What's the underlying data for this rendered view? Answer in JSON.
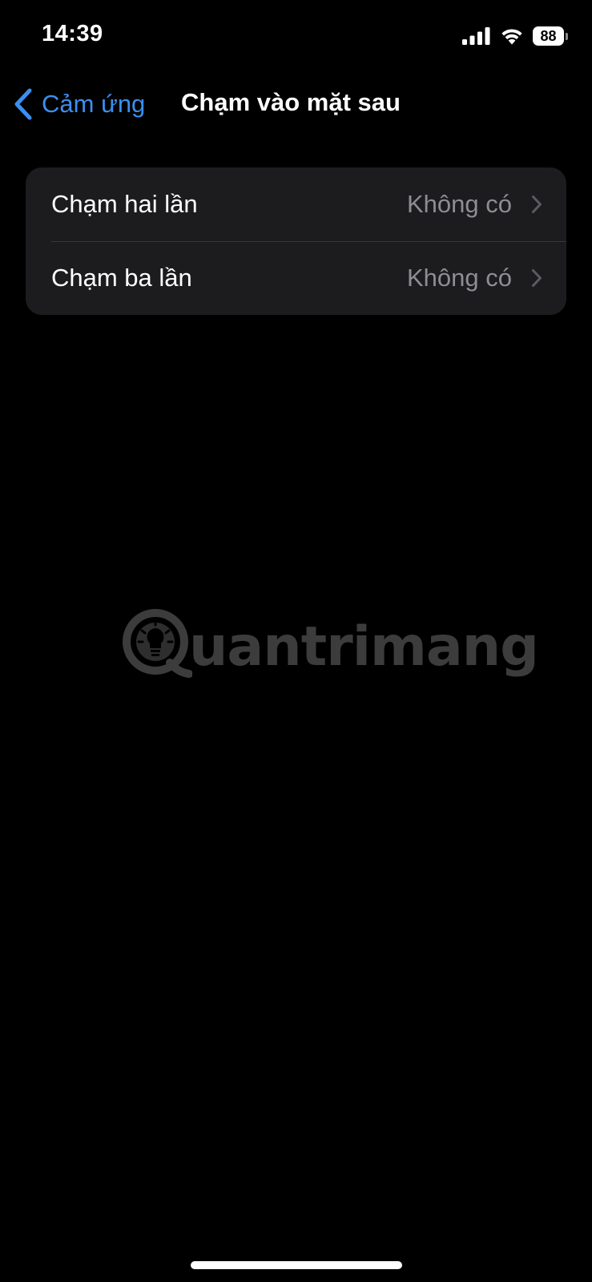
{
  "status_bar": {
    "time": "14:39",
    "battery_level": "88",
    "icons": [
      "signal-icon",
      "wifi-icon",
      "battery-icon"
    ]
  },
  "nav": {
    "back_label": "Cảm ứng",
    "title": "Chạm vào mặt sau",
    "back_icon": "chevron-left-icon"
  },
  "settings": {
    "rows": [
      {
        "label": "Chạm hai lần",
        "value": "Không có"
      },
      {
        "label": "Chạm ba lần",
        "value": "Không có"
      }
    ]
  },
  "watermark": {
    "text": "uantrimang",
    "icon": "lightbulb-logo-icon"
  },
  "colors": {
    "background": "#000000",
    "group_background": "#1c1c1e",
    "accent": "#3a8ff0",
    "secondary_text": "#8d8d93",
    "separator": "#38383a"
  }
}
